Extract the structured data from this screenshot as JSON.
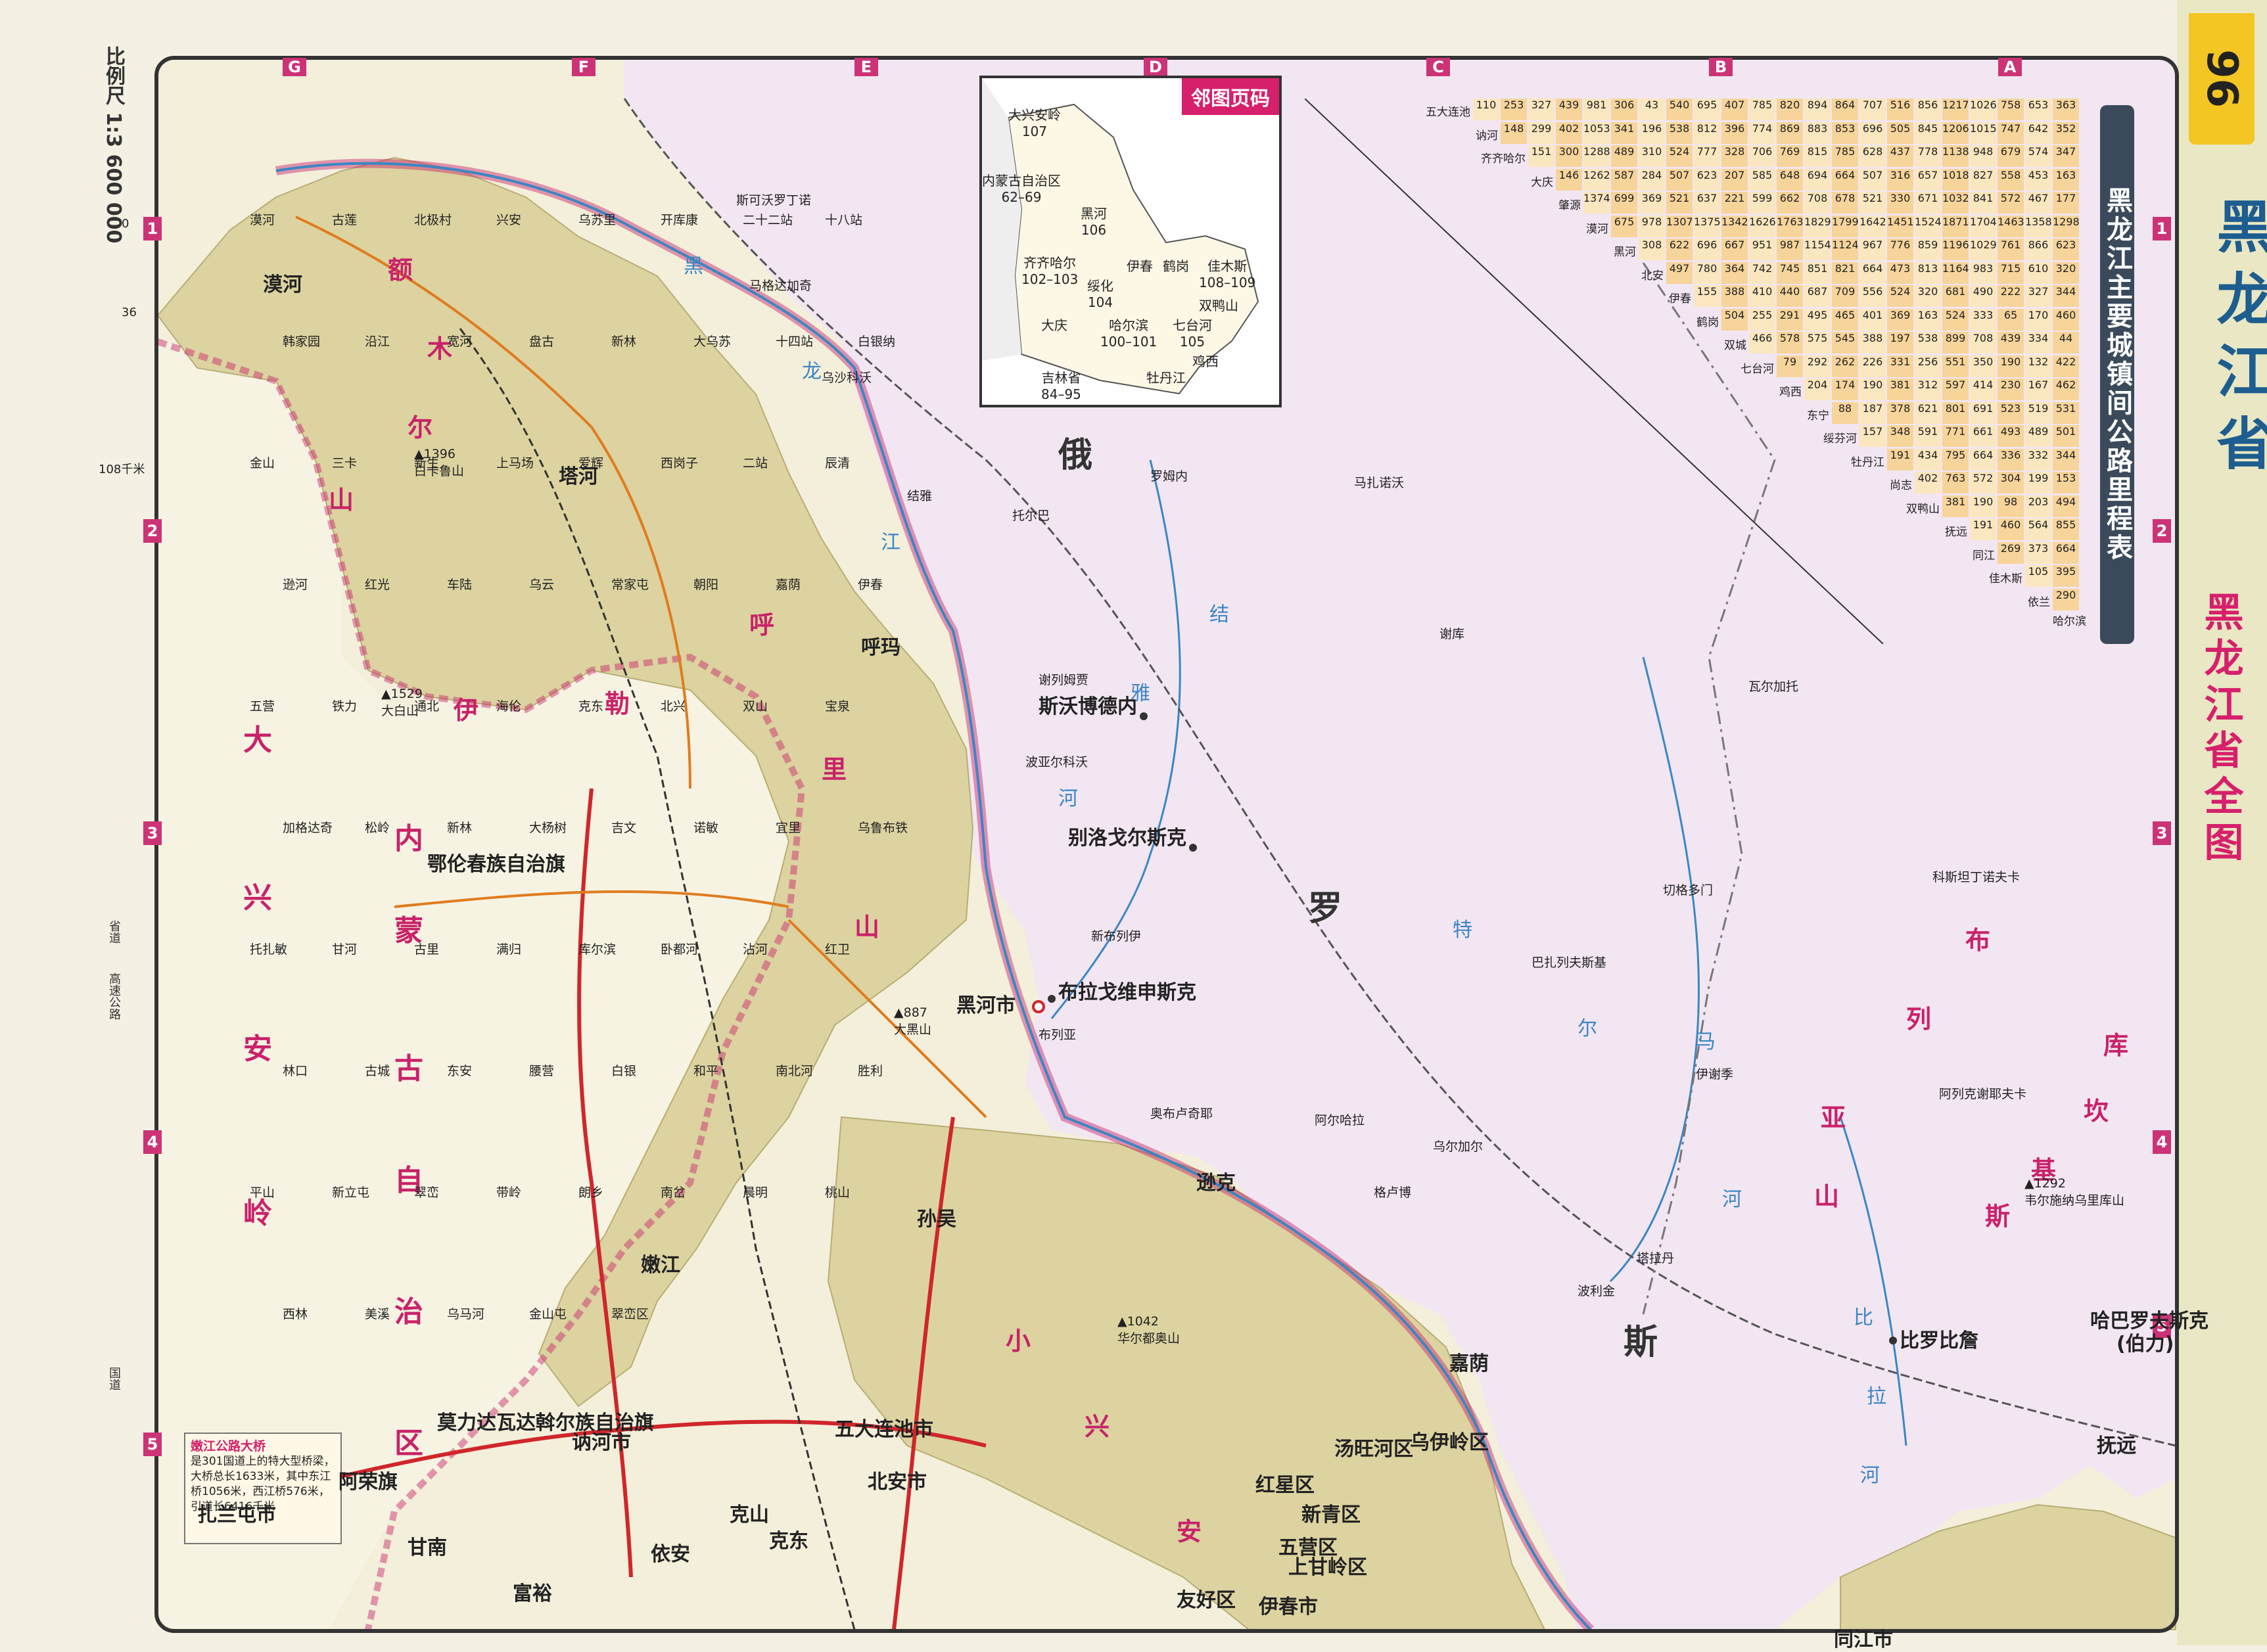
{
  "page": {
    "page_number": "96",
    "province_title": "黑龙江省",
    "map_title": "黑龙江省全图",
    "scale": "比例尺 1:3 600 000",
    "scale_ticks": [
      "0",
      "36",
      "108千米"
    ]
  },
  "grid": {
    "letters": [
      "G",
      "F",
      "E",
      "D",
      "C",
      "B",
      "A"
    ],
    "numbers": [
      "1",
      "2",
      "3",
      "4",
      "5"
    ]
  },
  "inset_map": {
    "header": "邻图页码",
    "labels": [
      {
        "name": "大兴安岭",
        "page": "107"
      },
      {
        "name": "内蒙古自治区",
        "page": "62–69"
      },
      {
        "name": "黑河",
        "page": "106"
      },
      {
        "name": "齐齐哈尔",
        "page": "102–103"
      },
      {
        "name": "绥化",
        "page": "104"
      },
      {
        "name": "伊春",
        "page": ""
      },
      {
        "name": "鹤岗",
        "page": ""
      },
      {
        "name": "佳木斯",
        "page": "108–109"
      },
      {
        "name": "双鸭山",
        "page": ""
      },
      {
        "name": "大庆",
        "page": ""
      },
      {
        "name": "哈尔滨",
        "page": "100–101"
      },
      {
        "name": "七台河",
        "page": "105"
      },
      {
        "name": "鸡西",
        "page": ""
      },
      {
        "name": "吉林省",
        "page": "84–95"
      },
      {
        "name": "牡丹江",
        "page": ""
      }
    ]
  },
  "mileage_table": {
    "title": "黑龙江主要城镇间公路里程表",
    "cities": [
      "五大连池",
      "讷河",
      "齐齐哈尔",
      "大庆",
      "肇源",
      "漠河",
      "黑河",
      "北安",
      "伊春",
      "鹤岗",
      "双城",
      "七台河",
      "鸡西",
      "东宁",
      "绥芬河",
      "牡丹江",
      "尚志",
      "双鸭山",
      "抚远",
      "同江",
      "佳木斯",
      "依兰",
      "哈尔滨"
    ],
    "rows": [
      [
        "110",
        "253",
        "327",
        "439",
        "981",
        "306",
        "43",
        "540",
        "695",
        "407",
        "785",
        "820",
        "894",
        "864",
        "707",
        "516",
        "856",
        "1217",
        "1026",
        "758",
        "653",
        "363"
      ],
      [
        "148",
        "299",
        "402",
        "1053",
        "341",
        "196",
        "538",
        "812",
        "396",
        "774",
        "869",
        "883",
        "853",
        "696",
        "505",
        "845",
        "1206",
        "1015",
        "747",
        "642",
        "352"
      ],
      [
        "151",
        "300",
        "1288",
        "489",
        "310",
        "524",
        "777",
        "328",
        "706",
        "769",
        "815",
        "785",
        "628",
        "437",
        "778",
        "1138",
        "948",
        "679",
        "574",
        "347"
      ],
      [
        "146",
        "1262",
        "587",
        "284",
        "507",
        "623",
        "207",
        "585",
        "648",
        "694",
        "664",
        "507",
        "316",
        "657",
        "1018",
        "827",
        "558",
        "453",
        "163"
      ],
      [
        "1374",
        "699",
        "369",
        "521",
        "637",
        "221",
        "599",
        "662",
        "708",
        "678",
        "521",
        "330",
        "671",
        "1032",
        "841",
        "572",
        "467",
        "177"
      ],
      [
        "675",
        "978",
        "1307",
        "1375",
        "1342",
        "1626",
        "1763",
        "1829",
        "1799",
        "1642",
        "1451",
        "1524",
        "1871",
        "1704",
        "1463",
        "1358",
        "1298"
      ],
      [
        "308",
        "622",
        "696",
        "667",
        "951",
        "987",
        "1154",
        "1124",
        "967",
        "776",
        "859",
        "1196",
        "1029",
        "761",
        "866",
        "623"
      ],
      [
        "497",
        "780",
        "364",
        "742",
        "745",
        "851",
        "821",
        "664",
        "473",
        "813",
        "1164",
        "983",
        "715",
        "610",
        "320"
      ],
      [
        "155",
        "388",
        "410",
        "440",
        "687",
        "709",
        "556",
        "524",
        "320",
        "681",
        "490",
        "222",
        "327",
        "344"
      ],
      [
        "504",
        "255",
        "291",
        "495",
        "465",
        "401",
        "369",
        "163",
        "524",
        "333",
        "65",
        "170",
        "460"
      ],
      [
        "466",
        "578",
        "575",
        "545",
        "388",
        "197",
        "538",
        "899",
        "708",
        "439",
        "334",
        "44"
      ],
      [
        "79",
        "292",
        "262",
        "226",
        "331",
        "256",
        "551",
        "350",
        "190",
        "132",
        "422"
      ],
      [
        "204",
        "174",
        "190",
        "381",
        "312",
        "597",
        "414",
        "230",
        "167",
        "462"
      ],
      [
        "88",
        "187",
        "378",
        "621",
        "801",
        "691",
        "523",
        "519",
        "531"
      ],
      [
        "157",
        "348",
        "591",
        "771",
        "661",
        "493",
        "489",
        "501"
      ],
      [
        "191",
        "434",
        "795",
        "664",
        "336",
        "332",
        "344"
      ],
      [
        "402",
        "763",
        "572",
        "304",
        "199",
        "153"
      ],
      [
        "381",
        "190",
        "98",
        "203",
        "494"
      ],
      [
        "191",
        "460",
        "564",
        "855"
      ],
      [
        "269",
        "373",
        "664"
      ],
      [
        "105",
        "395"
      ],
      [
        "290"
      ]
    ]
  },
  "labels": {
    "countries": [
      "俄",
      "罗",
      "斯"
    ],
    "regions": [
      "内",
      "蒙",
      "古",
      "自",
      "治",
      "区",
      "大",
      "兴",
      "安",
      "岭"
    ],
    "ranges": [
      "额",
      "木",
      "尔",
      "山",
      "伊",
      "勒",
      "呼",
      "里",
      "山",
      "小",
      "兴",
      "安",
      "布",
      "列",
      "亚",
      "山",
      "库",
      "坎",
      "基",
      "斯"
    ],
    "rivers": [
      "黑",
      "龙",
      "江",
      "结",
      "雅",
      "河",
      "特",
      "尔",
      "马",
      "河",
      "比",
      "拉",
      "河"
    ],
    "cities": [
      "漠河",
      "塔河",
      "呼玛",
      "黑河市",
      "孙吴",
      "嫩江",
      "五大连池市",
      "北安市",
      "讷河市",
      "克山",
      "克东",
      "依安",
      "富裕",
      "甘南",
      "阿荣旗",
      "扎兰屯市",
      "鄂伦春族自治旗",
      "莫力达瓦达斡尔族自治旗",
      "逊克",
      "嘉荫",
      "乌伊岭区",
      "汤旺河区",
      "红星区",
      "新青区",
      "五营区",
      "上甘岭区",
      "友好区",
      "伊春市",
      "抚远",
      "斯沃博德内",
      "别洛戈尔斯克",
      "布拉戈维申斯克",
      "比罗比詹",
      "哈巴罗夫斯克",
      "(伯力)",
      "同江市"
    ],
    "towns": [
      "漠河",
      "古莲",
      "北极村",
      "兴安",
      "乌苏里",
      "开库康",
      "二十二站",
      "十八站",
      "韩家园",
      "沿江",
      "宽河",
      "盘古",
      "新林",
      "大乌苏",
      "十四站",
      "白银纳",
      "金山",
      "三卡",
      "新生",
      "上马场",
      "爱辉",
      "西岗子",
      "二站",
      "辰清",
      "逊河",
      "红光",
      "车陆",
      "乌云",
      "常家屯",
      "朝阳",
      "嘉荫",
      "伊春",
      "五营",
      "铁力",
      "通北",
      "海伦",
      "克东",
      "北兴",
      "双山",
      "宝泉",
      "加格达奇",
      "松岭",
      "新林",
      "大杨树",
      "吉文",
      "诺敏",
      "宜里",
      "乌鲁布铁",
      "托扎敏",
      "甘河",
      "古里",
      "满归",
      "库尔滨",
      "卧都河",
      "沾河",
      "红卫",
      "林口",
      "古城",
      "东安",
      "腰营",
      "白银",
      "和平",
      "南北河",
      "胜利",
      "平山",
      "新立屯",
      "翠峦",
      "带岭",
      "朗乡",
      "南岔",
      "晨明",
      "桃山",
      "西林",
      "美溪",
      "乌马河",
      "金山屯",
      "翠峦区"
    ],
    "peaks": [
      {
        "name": "白卡鲁山",
        "elev": "1396"
      },
      {
        "name": "大白山",
        "elev": "1529"
      },
      {
        "name": "大黑山",
        "elev": "887"
      },
      {
        "name": "华尔都奥山",
        "elev": "1042"
      },
      {
        "name": "韦尔施纳乌里库山",
        "elev": "1292"
      }
    ],
    "russian_towns": [
      "斯可沃罗丁诺",
      "马格达加奇",
      "乌沙科沃",
      "结雅",
      "罗姆内",
      "马扎诺沃",
      "谢库",
      "托尔巴",
      "谢列姆贾",
      "波亚尔科沃",
      "新布列伊",
      "布列亚",
      "奥布卢奇耶",
      "阿尔哈拉",
      "乌尔加尔",
      "格卢博",
      "切格多门",
      "巴扎列夫斯基",
      "伊谢季",
      "瓦尔加托",
      "科斯坦丁诺夫卡",
      "阿列克谢耶夫卡",
      "塔拉丹",
      "波利金"
    ]
  },
  "info_box": {
    "title": "嫩江公路大桥",
    "text": "是301国道上的特大型桥梁，大桥总长1633米，其中东江桥1056米，西江桥576米，引道长6416千米"
  },
  "legend": {
    "items": [
      "省道",
      "高速公路",
      "国道"
    ]
  },
  "colors": {
    "russia": "#f2e6f2",
    "china_plain": "#f4f0dc",
    "mountain": "#d8cf9c",
    "border_magenta": "#c8226a",
    "river": "#3b86c4",
    "road": "#d0262b",
    "frame": "#333333",
    "page_tab": "#f3c623",
    "table_fill": "#fbe7bf"
  }
}
